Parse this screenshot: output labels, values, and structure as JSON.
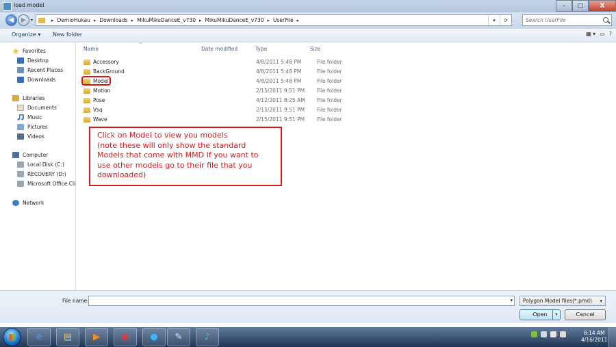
{
  "window": {
    "title": "load model",
    "min_label": "–",
    "max_label": "□",
    "close_label": "X"
  },
  "navigation": {
    "breadcrumbs": [
      "DemioHukau",
      "Downloads",
      "MikuMikuDanceE_v730",
      "MikuMikuDanceE_v730",
      "UserFile"
    ],
    "separator": "▸",
    "search_placeholder": "Search UserFile",
    "back_icon": "back-arrow-icon",
    "forward_icon": "forward-arrow-icon"
  },
  "toolbar": {
    "organize_label": "Organize ▾",
    "new_folder_label": "New folder",
    "views_label": "▦ ▾",
    "preview_label": "▭",
    "help_label": "?"
  },
  "sidebar": {
    "favorites": {
      "label": "Favorites",
      "items": [
        "Desktop",
        "Recent Places",
        "Downloads"
      ]
    },
    "libraries": {
      "label": "Libraries",
      "items": [
        "Documents",
        "Music",
        "Pictures",
        "Videos"
      ]
    },
    "computer": {
      "label": "Computer",
      "items": [
        "Local Disk (C:)",
        "RECOVERY (D:)",
        "Microsoft Office Clic"
      ]
    },
    "network": {
      "label": "Network"
    }
  },
  "columns": {
    "name": "Name",
    "date": "Date modified",
    "type": "Type",
    "size": "Size"
  },
  "files": [
    {
      "name": "Accessory",
      "date": "4/8/2011 5:48 PM",
      "type": "File folder"
    },
    {
      "name": "BackGround",
      "date": "4/8/2011 5:48 PM",
      "type": "File folder"
    },
    {
      "name": "Model",
      "date": "4/8/2011 5:48 PM",
      "type": "File folder"
    },
    {
      "name": "Motion",
      "date": "2/15/2011 9:51 PM",
      "type": "File folder"
    },
    {
      "name": "Pose",
      "date": "4/12/2011 8:25 AM",
      "type": "File folder"
    },
    {
      "name": "Vsq",
      "date": "2/15/2011 9:51 PM",
      "type": "File folder"
    },
    {
      "name": "Wave",
      "date": "2/15/2011 9:51 PM",
      "type": "File folder"
    }
  ],
  "annotation": {
    "lines": [
      "Click on Model to view you models",
      "(note these will only show the standard",
      "Models that come with MMD If you want to",
      "use other models go to their file that you",
      "downloaded)"
    ],
    "color": "#d81919"
  },
  "bottom": {
    "filename_label": "File name:",
    "filename_value": "",
    "filetype_value": "Polygon Model files(*.pmd)",
    "open_label": "Open",
    "cancel_label": "Cancel"
  },
  "taskbar": {
    "icons": [
      "internet-explorer-icon",
      "explorer-icon",
      "media-player-icon",
      "chrome-icon",
      "app-icon",
      "paint-icon",
      "miku-icon"
    ],
    "time": "8:14 AM",
    "date": "4/16/2011"
  }
}
